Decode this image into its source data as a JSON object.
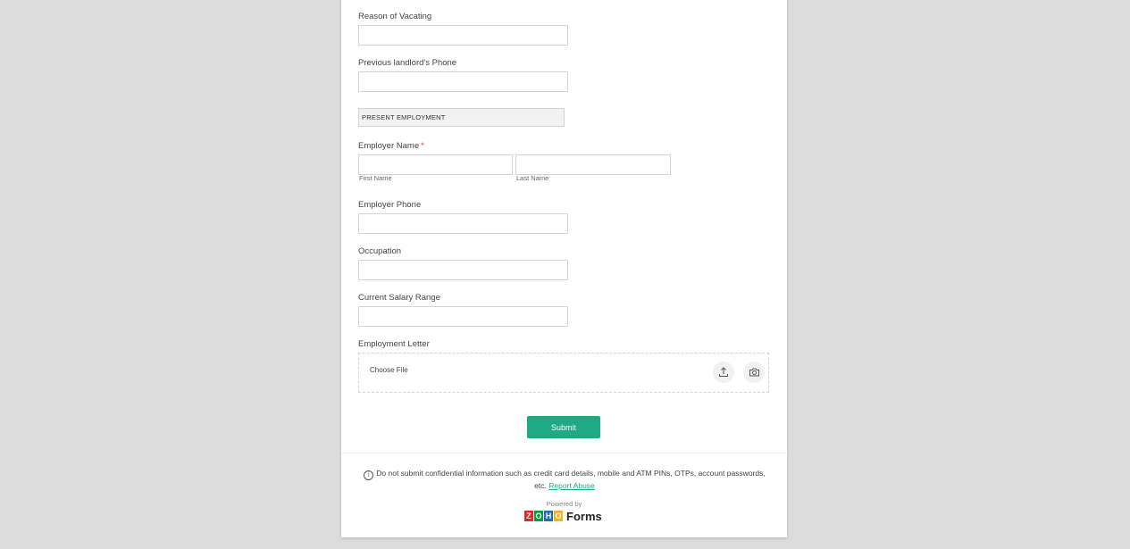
{
  "form": {
    "fields": {
      "reason_label": "Reason of Vacating",
      "prev_landlord_phone_label": "Previous landlord's Phone",
      "section_present_employment": "PRESENT EMPLOYMENT",
      "employer_name_label": "Employer Name",
      "required_mark": "*",
      "first_name_sublabel": "First Name",
      "last_name_sublabel": "Last Name",
      "employer_phone_label": "Employer Phone",
      "occupation_label": "Occupation",
      "salary_label": "Current Salary Range",
      "employment_letter_label": "Employment Letter",
      "choose_file": "Choose File"
    },
    "values": {
      "reason": "",
      "prev_landlord_phone": "",
      "employer_first_name": "",
      "employer_last_name": "",
      "employer_phone": "",
      "occupation": "",
      "salary": ""
    },
    "submit_label": "Submit"
  },
  "footer": {
    "notice_text": "Do not submit confidential information such as credit card details, mobile and ATM PINs, OTPs, account passwords, etc.",
    "report_abuse": "Report Abuse",
    "powered_by": "Powered by",
    "brand_letters": [
      "Z",
      "O",
      "H",
      "O"
    ],
    "brand_product": "Forms"
  },
  "colors": {
    "accent": "#20a985",
    "required": "#e53935",
    "page_bg": "#dcdcdc",
    "zoho_z": "#e42527",
    "zoho_o1": "#089949",
    "zoho_h": "#226db4",
    "zoho_o2": "#f9b21d"
  },
  "icons": {
    "upload": "upload-icon",
    "camera": "camera-icon",
    "info": "info-icon"
  }
}
